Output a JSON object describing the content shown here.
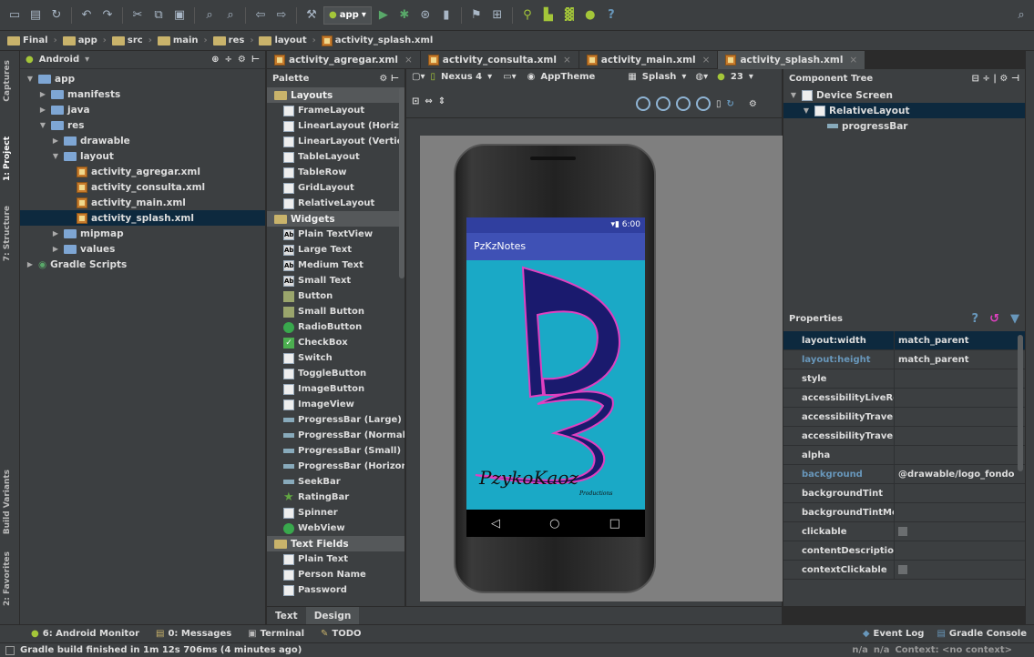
{
  "toolbar": {
    "run_config": "app",
    "help": "?"
  },
  "breadcrumb": [
    "Final",
    "app",
    "src",
    "main",
    "res",
    "layout",
    "activity_splash.xml"
  ],
  "side_tabs": {
    "captures": "Captures",
    "project": "1: Project",
    "structure": "7: Structure",
    "build_variants": "Build Variants",
    "favorites": "2: Favorites"
  },
  "project": {
    "view": "Android",
    "tree": [
      {
        "label": "app",
        "depth": 0,
        "arrow": "▼",
        "icon": "folder"
      },
      {
        "label": "manifests",
        "depth": 1,
        "arrow": "▶",
        "icon": "folder"
      },
      {
        "label": "java",
        "depth": 1,
        "arrow": "▶",
        "icon": "folder"
      },
      {
        "label": "res",
        "depth": 1,
        "arrow": "▼",
        "icon": "folder"
      },
      {
        "label": "drawable",
        "depth": 2,
        "arrow": "▶",
        "icon": "folder"
      },
      {
        "label": "layout",
        "depth": 2,
        "arrow": "▼",
        "icon": "folder"
      },
      {
        "label": "activity_agregar.xml",
        "depth": 3,
        "arrow": "",
        "icon": "xml"
      },
      {
        "label": "activity_consulta.xml",
        "depth": 3,
        "arrow": "",
        "icon": "xml"
      },
      {
        "label": "activity_main.xml",
        "depth": 3,
        "arrow": "",
        "icon": "xml"
      },
      {
        "label": "activity_splash.xml",
        "depth": 3,
        "arrow": "",
        "icon": "xml",
        "selected": true
      },
      {
        "label": "mipmap",
        "depth": 2,
        "arrow": "▶",
        "icon": "folder"
      },
      {
        "label": "values",
        "depth": 2,
        "arrow": "▶",
        "icon": "folder"
      },
      {
        "label": "Gradle Scripts",
        "depth": 0,
        "arrow": "▶",
        "icon": "gradle"
      }
    ]
  },
  "editor_tabs": [
    "activity_agregar.xml",
    "activity_consulta.xml",
    "activity_main.xml",
    "activity_splash.xml"
  ],
  "palette": {
    "title": "Palette",
    "sections": [
      {
        "title": "Layouts",
        "items": [
          {
            "label": "FrameLayout",
            "icon": "box"
          },
          {
            "label": "LinearLayout (Horizontal)",
            "icon": "box"
          },
          {
            "label": "LinearLayout (Vertical)",
            "icon": "box"
          },
          {
            "label": "TableLayout",
            "icon": "box"
          },
          {
            "label": "TableRow",
            "icon": "box"
          },
          {
            "label": "GridLayout",
            "icon": "box"
          },
          {
            "label": "RelativeLayout",
            "icon": "box"
          }
        ]
      },
      {
        "title": "Widgets",
        "items": [
          {
            "label": "Plain TextView",
            "icon": "ab"
          },
          {
            "label": "Large Text",
            "icon": "ab"
          },
          {
            "label": "Medium Text",
            "icon": "ab"
          },
          {
            "label": "Small Text",
            "icon": "ab"
          },
          {
            "label": "Button",
            "icon": "btn"
          },
          {
            "label": "Small Button",
            "icon": "btn"
          },
          {
            "label": "RadioButton",
            "icon": "radio"
          },
          {
            "label": "CheckBox",
            "icon": "check"
          },
          {
            "label": "Switch",
            "icon": "box"
          },
          {
            "label": "ToggleButton",
            "icon": "box"
          },
          {
            "label": "ImageButton",
            "icon": "box"
          },
          {
            "label": "ImageView",
            "icon": "box"
          },
          {
            "label": "ProgressBar (Large)",
            "icon": "pb"
          },
          {
            "label": "ProgressBar (Normal)",
            "icon": "pb"
          },
          {
            "label": "ProgressBar (Small)",
            "icon": "pb"
          },
          {
            "label": "ProgressBar (Horizontal)",
            "icon": "pb"
          },
          {
            "label": "SeekBar",
            "icon": "pb"
          },
          {
            "label": "RatingBar",
            "icon": "star"
          },
          {
            "label": "Spinner",
            "icon": "box"
          },
          {
            "label": "WebView",
            "icon": "radio"
          }
        ]
      },
      {
        "title": "Text Fields",
        "items": [
          {
            "label": "Plain Text",
            "icon": "box"
          },
          {
            "label": "Person Name",
            "icon": "box"
          },
          {
            "label": "Password",
            "icon": "box"
          }
        ]
      }
    ]
  },
  "design_toolbar": {
    "device": "Nexus 4",
    "theme": "AppTheme",
    "activity": "Splash",
    "api": "23"
  },
  "phone": {
    "time": "6:00",
    "app_title": "PzKzNotes",
    "logo_text": "PzykoKaoz",
    "logo_subtext": "Productions",
    "nav_back": "◁",
    "nav_home": "○",
    "nav_recent": "□"
  },
  "design_tabs": [
    "Text",
    "Design"
  ],
  "component_tree": {
    "title": "Component Tree",
    "nodes": [
      {
        "label": "Device Screen",
        "depth": 0
      },
      {
        "label": "RelativeLayout",
        "depth": 1,
        "selected": true
      },
      {
        "label": "progressBar",
        "depth": 2
      }
    ]
  },
  "properties": {
    "title": "Properties",
    "rows": [
      {
        "key": "layout:width",
        "value": "match_parent",
        "selected": true
      },
      {
        "key": "layout:height",
        "value": "match_parent",
        "modified": true
      },
      {
        "key": "style",
        "value": ""
      },
      {
        "key": "accessibilityLiveRegion",
        "value": ""
      },
      {
        "key": "accessibilityTraversalAfter",
        "value": ""
      },
      {
        "key": "accessibilityTraversalBefore",
        "value": ""
      },
      {
        "key": "alpha",
        "value": ""
      },
      {
        "key": "background",
        "value": "@drawable/logo_fondo",
        "modified": true
      },
      {
        "key": "backgroundTint",
        "value": ""
      },
      {
        "key": "backgroundTintMode",
        "value": ""
      },
      {
        "key": "clickable",
        "value": "",
        "checkbox": true
      },
      {
        "key": "contentDescription",
        "value": ""
      },
      {
        "key": "contextClickable",
        "value": "",
        "checkbox": true
      }
    ]
  },
  "tool_windows": [
    {
      "label": "6: Android Monitor",
      "icon": "android"
    },
    {
      "label": "0: Messages",
      "icon": "msg"
    },
    {
      "label": "Terminal",
      "icon": "term"
    },
    {
      "label": "TODO",
      "icon": "todo"
    }
  ],
  "right_tools": [
    "Event Log",
    "Gradle Console"
  ],
  "status": {
    "message": "Gradle build finished in 1m 12s 706ms (4 minutes ago)",
    "pos1": "n/a",
    "pos2": "n/a",
    "context": "Context: <no context>"
  },
  "colors": {
    "ide_bg": "#3c3f41",
    "selection": "#0d293e",
    "app_primary": "#3f51b5",
    "screen_bg": "#1aa9c6",
    "logo_dark": "#1a1a6e",
    "logo_pink": "#e040c0"
  }
}
